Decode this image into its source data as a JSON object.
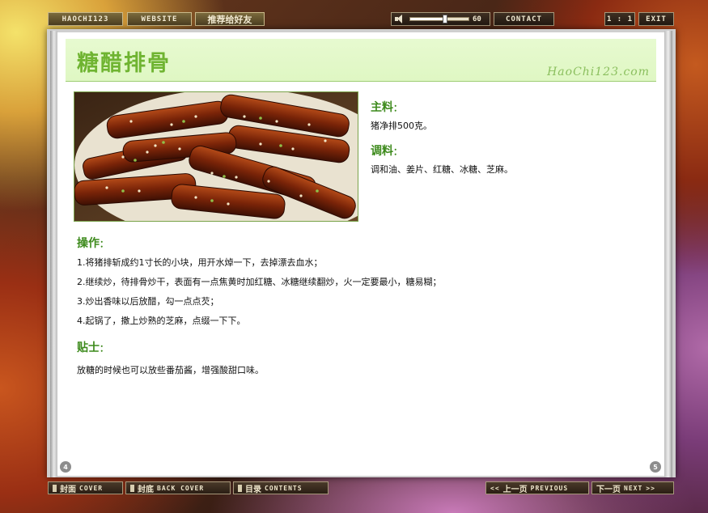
{
  "topbar": {
    "haochi": "HAOCHI123",
    "website": "WEBSITE",
    "recommend": "推荐给好友",
    "volume_value": "60",
    "volume_level": 0.6,
    "contact": "CONTACT",
    "zoom": "1 : 1",
    "exit": "EXIT"
  },
  "page": {
    "title": "糖醋排骨",
    "site": "HaoChi123.com",
    "main_heading": "主料",
    "main_text": "猪净排500克。",
    "season_heading": "调料",
    "season_text": "调和油、姜片、红糖、冰糖、芝麻。",
    "steps_heading": "操作",
    "steps": [
      "1.将猪排斩成约1寸长的小块，用开水焯一下，去掉漂去血水；",
      "2.继续炒，待排骨炒干，表面有一点焦黄时加红糖、冰糖继续翻炒，火一定要最小，糖易糊；",
      "3.炒出香味以后放醋，勾一点点芡；",
      "4.起锅了，撒上炒熟的芝麻，点缀一下下。"
    ],
    "tips_heading": "贴士",
    "tips_text": "放糖的时候也可以放些番茄酱，增强酸甜口味。",
    "colon": "：",
    "left_page_num": "4",
    "right_page_num": "5"
  },
  "bottombar": {
    "cover_cn": "封面",
    "cover_en": "COVER",
    "back_cn": "封底",
    "back_en": "BACK COVER",
    "contents_cn": "目录",
    "contents_en": "CONTENTS",
    "prev_arrow": "<<",
    "prev_cn": "上一页",
    "prev_en": "PREVIOUS",
    "next_cn": "下一页",
    "next_en": "NEXT",
    "next_arrow": ">>"
  }
}
